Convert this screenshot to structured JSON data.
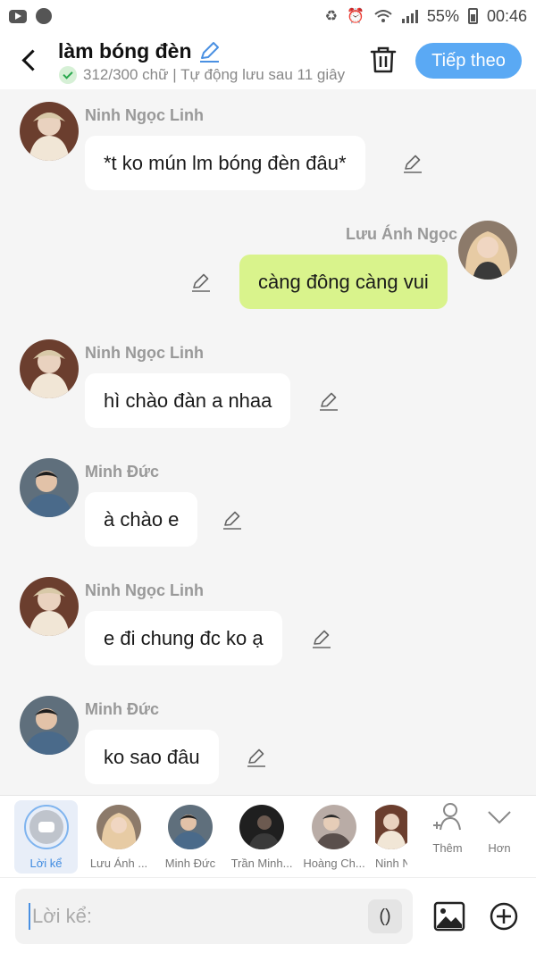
{
  "status_bar": {
    "battery": "55%",
    "time": "00:46",
    "left_icons": [
      "youtube-icon",
      "globe-icon"
    ],
    "right_icons": [
      "recycle-icon",
      "alarm-icon",
      "wifi-icon",
      "signal-icon",
      "battery-icon"
    ]
  },
  "header": {
    "title": "làm bóng đèn",
    "subtitle": "312/300 chữ | Tự động lưu sau 11 giây",
    "next_label": "Tiếp theo"
  },
  "messages": [
    {
      "sender": "Ninh Ngọc Linh",
      "text": "*t ko mún lm bóng đèn đâu*",
      "side": "left",
      "avatar_color": "#7a4e3a"
    },
    {
      "sender": "Lưu Ánh Ngọc",
      "text": "càng đông càng vui",
      "side": "right",
      "avatar_color": "#c9a27f"
    },
    {
      "sender": "Ninh Ngọc Linh",
      "text": "hì chào đàn a nhaa",
      "side": "left",
      "avatar_color": "#7a4e3a"
    },
    {
      "sender": "Minh Đức",
      "text": "à chào e",
      "side": "left",
      "avatar_color": "#4d5a66"
    },
    {
      "sender": "Ninh Ngọc Linh",
      "text": "e đi chung đc ko ạ",
      "side": "left",
      "avatar_color": "#7a4e3a"
    },
    {
      "sender": "Minh Đức",
      "text": "ko sao đâu",
      "side": "left",
      "avatar_color": "#4d5a66"
    }
  ],
  "characters": {
    "narrator": "Lời kể",
    "items": [
      {
        "name": "Lưu Ánh ...",
        "color": "#c9a27f"
      },
      {
        "name": "Minh Đức",
        "color": "#4d5a66"
      },
      {
        "name": "Trần Minh...",
        "color": "#2b2b2b"
      },
      {
        "name": "Hoàng Ch...",
        "color": "#8a7c78"
      },
      {
        "name": "Ninh N",
        "color": "#7a4e3a"
      }
    ],
    "add_label": "Thêm",
    "more_label": "Hơn"
  },
  "input": {
    "placeholder": "Lời kể:",
    "paren_label": "()"
  },
  "colors": {
    "accent": "#5aa9f4",
    "right_bubble": "#d9f38c",
    "left_bubble": "#ffffff"
  }
}
